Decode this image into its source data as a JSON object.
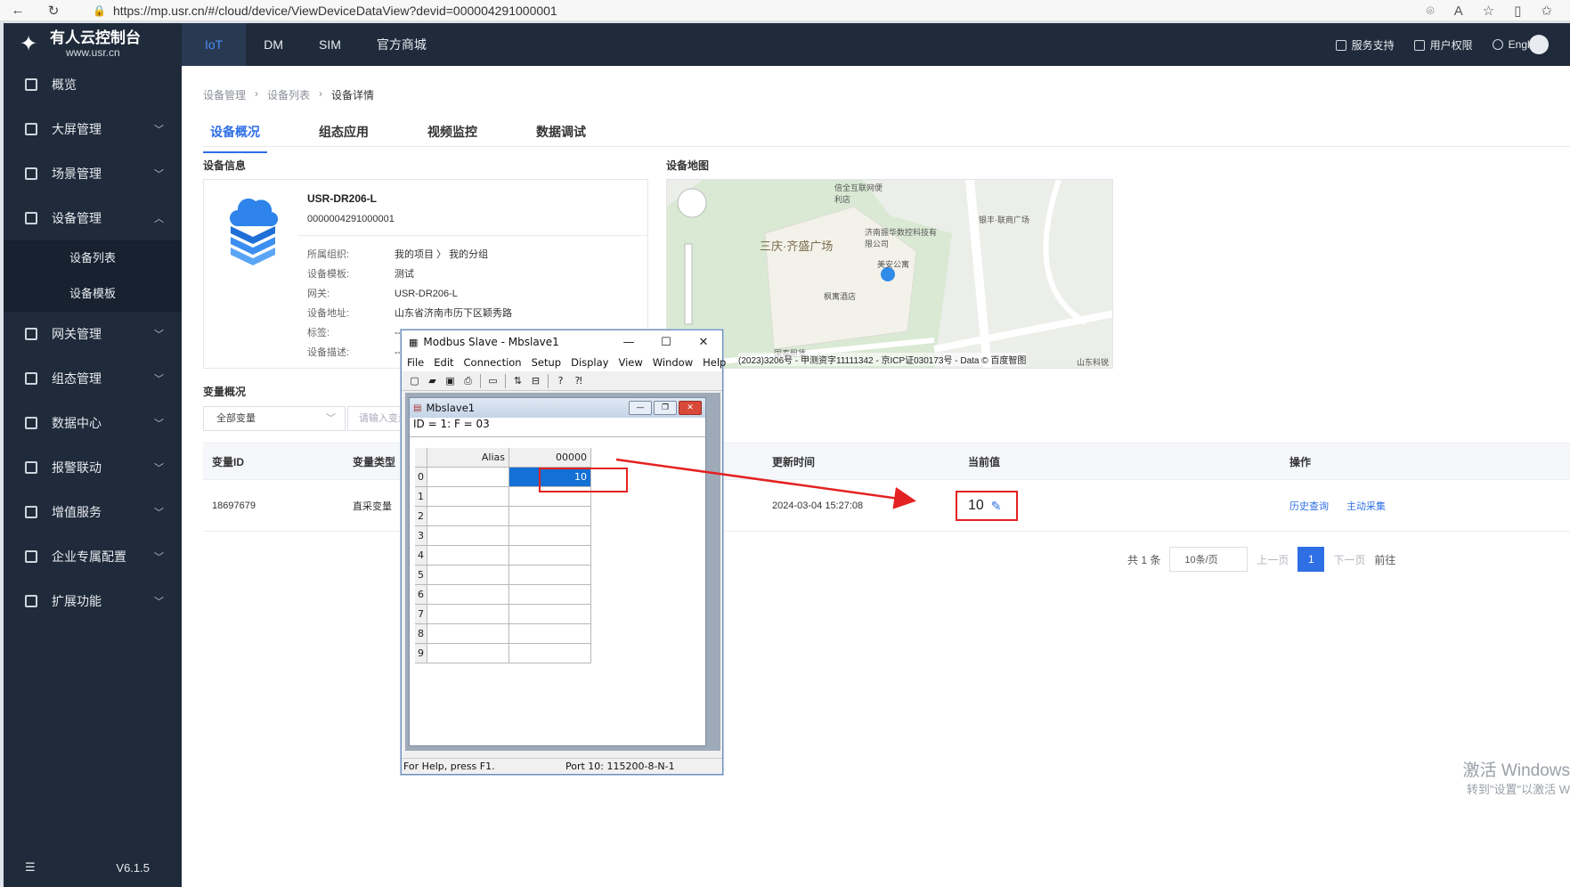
{
  "browser": {
    "url": "https://mp.usr.cn/#/cloud/device/ViewDeviceDataView?devid=000004291000001"
  },
  "brand": {
    "title": "有人云控制台",
    "subtitle": "www.usr.cn"
  },
  "sidebar": {
    "items": [
      {
        "label": "概览"
      },
      {
        "label": "大屏管理"
      },
      {
        "label": "场景管理"
      },
      {
        "label": "设备管理"
      },
      {
        "label": "网关管理"
      },
      {
        "label": "组态管理"
      },
      {
        "label": "数据中心"
      },
      {
        "label": "报警联动"
      },
      {
        "label": "增值服务"
      },
      {
        "label": "企业专属配置"
      },
      {
        "label": "扩展功能"
      }
    ],
    "sub_items": [
      {
        "label": "设备列表"
      },
      {
        "label": "设备模板"
      }
    ],
    "version": "V6.1.5"
  },
  "topnav": {
    "items": [
      {
        "label": "IoT"
      },
      {
        "label": "DM"
      },
      {
        "label": "SIM"
      },
      {
        "label": "官方商城"
      }
    ],
    "right": [
      {
        "label": "服务支持"
      },
      {
        "label": "用户权限"
      },
      {
        "label": "English"
      }
    ]
  },
  "breadcrumb": [
    "设备管理",
    "设备列表",
    "设备详情"
  ],
  "tabs": [
    "设备概况",
    "组态应用",
    "视频监控",
    "数据调试"
  ],
  "device_info": {
    "section_title": "设备信息",
    "name": "USR-DR206-L",
    "id": "0000004291000001",
    "fields": [
      {
        "k": "所属组织:",
        "v": "我的项目 〉 我的分组"
      },
      {
        "k": "设备模板:",
        "v": "测试"
      },
      {
        "k": "网关:",
        "v": "USR-DR206-L"
      },
      {
        "k": "设备地址:",
        "v": "山东省济南市历下区颖秀路"
      },
      {
        "k": "标签:",
        "v": "--"
      },
      {
        "k": "设备描述:",
        "v": "--"
      }
    ]
  },
  "map": {
    "section_title": "设备地图",
    "labels": [
      "三庆·齐盛广场",
      "济南振华数控科技有限公司",
      "美安公寓",
      "枫寓酒店",
      "银丰·联商广场",
      "倍全互联网便利店",
      "国泰租赁",
      "山东科锐"
    ],
    "credit": "(2023)3206号 - 甲测资字11111342 - 京ICP证030173号 - Data © 百度智图"
  },
  "variables": {
    "section_title": "变量概况",
    "filter": "全部变量",
    "search_placeholder": "请输入变量名",
    "columns": [
      "变量ID",
      "变量类型",
      "更新时间",
      "当前值",
      "操作"
    ],
    "rows": [
      {
        "id": "18697679",
        "type": "直采变量",
        "time": "2024-03-04 15:27:08",
        "value": "10",
        "actions": [
          "历史查询",
          "主动采集"
        ]
      }
    ]
  },
  "pager": {
    "total": "共 1 条",
    "size": "10条/页",
    "prev": "上一页",
    "page": "1",
    "next": "下一页",
    "goto": "前往"
  },
  "watermark": {
    "line1": "激活 Windows",
    "line2": "转到\"设置\"以激活 W"
  },
  "modbus": {
    "title": "Modbus Slave - Mbslave1",
    "menu": [
      "File",
      "Edit",
      "Connection",
      "Setup",
      "Display",
      "View",
      "Window",
      "Help"
    ],
    "child_title": "Mbslave1",
    "header_line": "ID = 1: F = 03",
    "col_alias": "Alias",
    "col_addr": "00000",
    "rows": [
      "0",
      "1",
      "2",
      "3",
      "4",
      "5",
      "6",
      "7",
      "8",
      "9"
    ],
    "row0_value": "10",
    "status_left": "For Help, press F1.",
    "status_right": "Port 10: 115200-8-N-1"
  }
}
